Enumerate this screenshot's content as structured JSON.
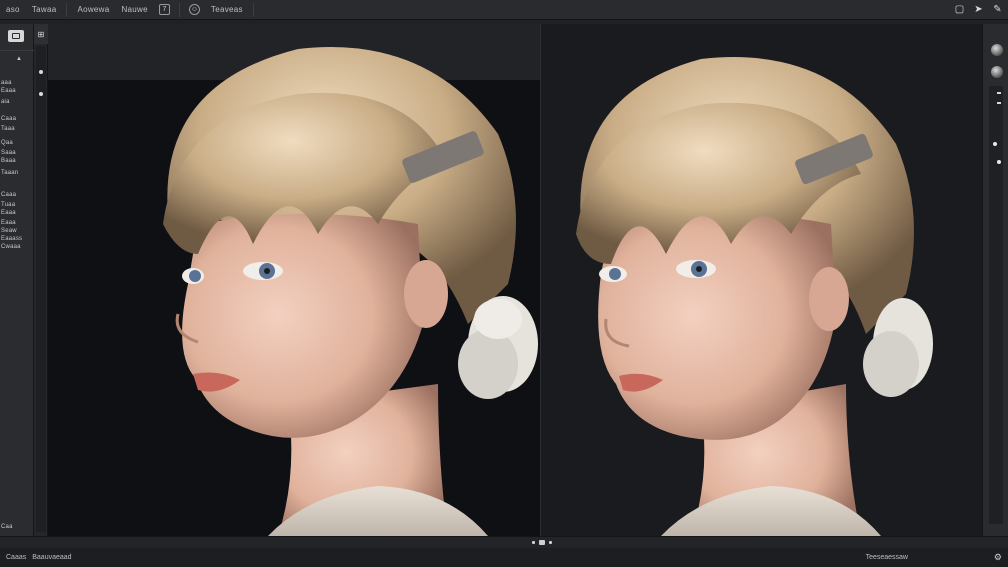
{
  "menubar": {
    "items": [
      "aso",
      "Tawaa",
      "Aowewa",
      "Nauwe"
    ],
    "icon_a": "7",
    "icon_b": "☺",
    "item_last": "Teaveas",
    "right_icons": [
      "window-icon",
      "pointer-icon",
      "pin-icon"
    ]
  },
  "left_panel": {
    "rows": [
      "aaa",
      "Eaaa",
      "aia",
      "Caaa",
      "Taaa",
      "Qaa",
      "Saaa",
      "Baaa",
      "Taaan",
      "Caaa",
      "Tuaa",
      "Eaaa",
      "Eaaa",
      "Seaw",
      "Eaaass",
      "Cwaaa"
    ],
    "footer": "Caa"
  },
  "col2": {
    "top_icon": "⊞"
  },
  "viewports": {
    "left": {
      "name": "left-portrait",
      "content": "portrait render"
    },
    "right": {
      "name": "right-portrait",
      "content": "portrait render"
    }
  },
  "statusbar": {
    "left_a": "Caaas",
    "left_b": "Baauvaeaad",
    "right": "Teeseaessaw"
  },
  "colors": {
    "background": "#1c1d20",
    "panel": "#2b2c30",
    "viewport": "#17181c",
    "hair": "#c9ad86",
    "skin": "#e3b8a3",
    "sweater": "#d9cfc4"
  }
}
